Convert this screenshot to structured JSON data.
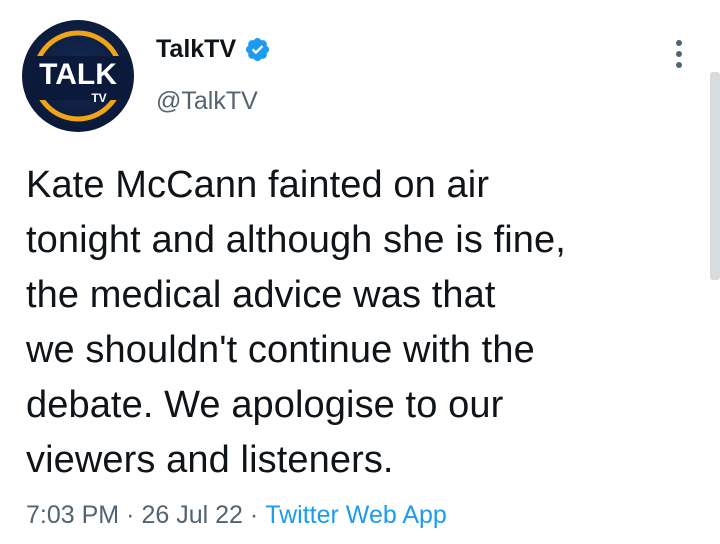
{
  "author": {
    "display_name": "TalkTV",
    "handle": "@TalkTV",
    "verified": true,
    "avatar_text": "TALK",
    "avatar_subtext": "TV"
  },
  "tweet": {
    "text": "Kate McCann fainted on air\ntonight and although she is fine,\nthe medical advice was that\nwe shouldn't continue with the\ndebate. We apologise to our\nviewers and listeners.",
    "time": "7:03 PM",
    "date": "26 Jul 22",
    "source": "Twitter Web App",
    "separator": "·"
  },
  "icons": {
    "verified": "verified-badge-icon",
    "more": "more-options-icon"
  },
  "colors": {
    "accent": "#1d9bf0",
    "secondary_text": "#536471",
    "primary_text": "#0f1419",
    "avatar_bg": "#0b1a3a",
    "avatar_ring": "#f0a417"
  }
}
